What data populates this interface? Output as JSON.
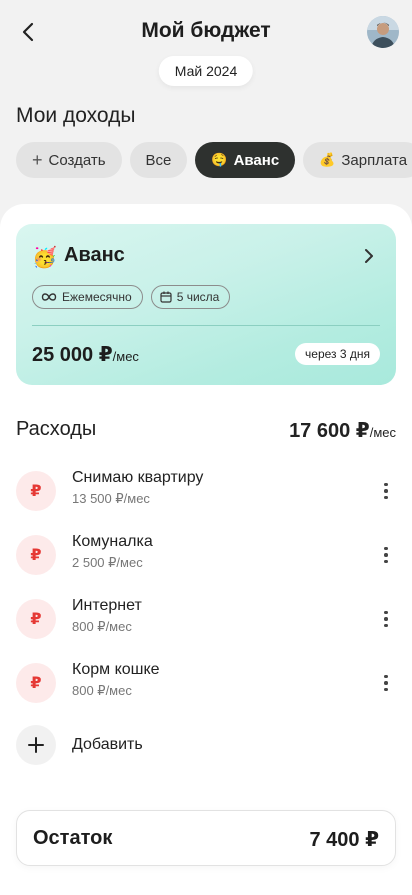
{
  "header": {
    "title": "Мой бюджет",
    "back_icon": "chevron-left-icon",
    "avatar_icon": "user-avatar"
  },
  "month": "Май 2024",
  "incomes": {
    "title": "Мои доходы",
    "chips": [
      {
        "label": "Создать",
        "icon": "plus-icon"
      },
      {
        "label": "Все"
      },
      {
        "label": "Аванс",
        "emoji": "🤤",
        "active": true
      },
      {
        "label": "Зарплата",
        "emoji": "💰"
      }
    ]
  },
  "income_card": {
    "emoji": "🥳",
    "title": "Аванс",
    "tags": [
      {
        "label": "Ежемесячно",
        "icon": "infinity-icon"
      },
      {
        "label": "5 числа",
        "icon": "calendar-icon"
      }
    ],
    "amount": "25 000 ₽",
    "amount_unit": "/мес",
    "due": "через 3 дня"
  },
  "expenses": {
    "title": "Расходы",
    "total": "17 600 ₽",
    "total_unit": "/мес",
    "items": [
      {
        "name": "Снимаю квартиру",
        "amount": "13 500 ₽/мес",
        "icon": "₽"
      },
      {
        "name": "Комуналка",
        "amount": "2 500 ₽/мес",
        "icon": "₽"
      },
      {
        "name": "Интернет",
        "amount": "800 ₽/мес",
        "icon": "₽"
      },
      {
        "name": "Корм кошке",
        "amount": "800 ₽/мес",
        "icon": "₽"
      }
    ],
    "add_label": "Добавить"
  },
  "balance": {
    "label": "Остаток",
    "value": "7 400 ₽"
  },
  "colors": {
    "accent_dark": "#2e312f",
    "rub_red": "#e53935",
    "card_mint": "#b3ece0"
  }
}
